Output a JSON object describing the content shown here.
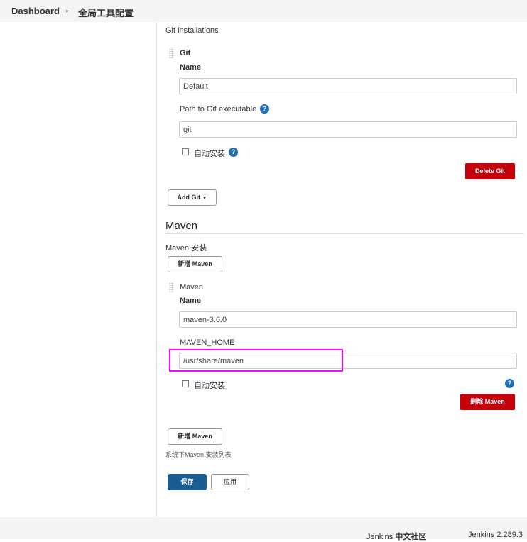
{
  "breadcrumb": {
    "home": "Dashboard",
    "current": "全局工具配置"
  },
  "git": {
    "installations_label": "Git installations",
    "entry_title": "Git",
    "name_label": "Name",
    "name_value": "Default",
    "path_label": "Path to Git executable",
    "path_value": "git",
    "auto_install_label": "自动安装",
    "delete_label": "Delete Git",
    "add_label": "Add Git"
  },
  "maven": {
    "section_title": "Maven",
    "installations_label": "Maven 安装",
    "add_label_top": "新增 Maven",
    "entry_title": "Maven",
    "name_label": "Name",
    "name_value": "maven-3.6.0",
    "home_label": "MAVEN_HOME",
    "home_value": "/usr/share/maven",
    "auto_install_label": "自动安装",
    "delete_label": "删除 Maven",
    "add_label_bottom": "新增 Maven",
    "list_description": "系统下Maven 安装列表"
  },
  "actions": {
    "save_label": "保存",
    "apply_label": "应用"
  },
  "footer": {
    "community_prefix": "Jenkins ",
    "community_bold": "中文社区",
    "version": "Jenkins 2.289.3"
  },
  "icons": {
    "help": "help-icon",
    "caret": "caret-down-icon",
    "breadcrumb_sep": "chevron-right-icon"
  },
  "colors": {
    "danger": "#c4000a",
    "primary": "#1a5d93",
    "help": "#1f6fb7",
    "highlight": "#ff00ff"
  }
}
